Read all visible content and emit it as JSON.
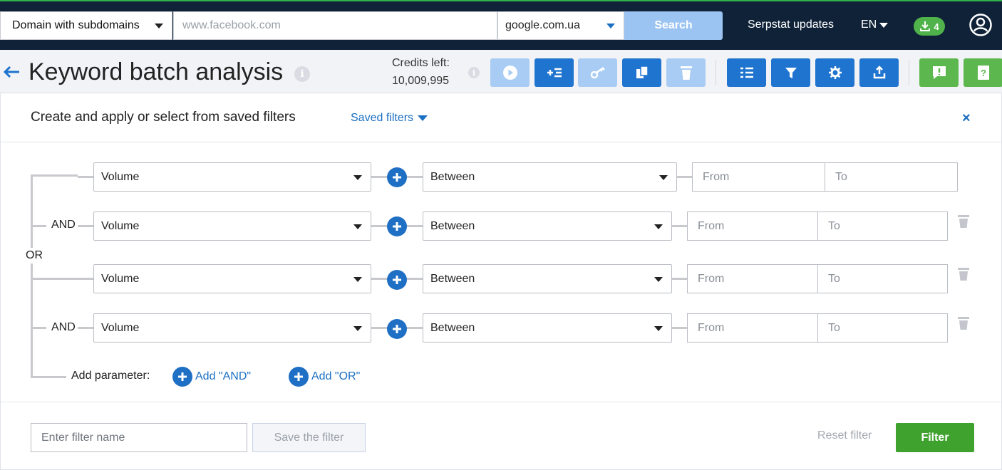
{
  "topbar": {
    "scope_selected": "Domain with subdomains",
    "domain_placeholder": "www.facebook.com",
    "database_selected": "google.com.ua",
    "search_label": "Search",
    "updates_label": "Serpstat updates",
    "language": "EN",
    "downloads_count": "4"
  },
  "header": {
    "title": "Keyword batch analysis",
    "credits_label": "Credits left:",
    "credits_value": "10,009,995",
    "toolbar_icons": [
      "play-icon",
      "add-list-icon",
      "key-icon",
      "copy-icon",
      "trash-icon",
      "list-icon",
      "filter-icon",
      "gear-icon",
      "export-icon",
      "feedback-icon",
      "help-book-icon"
    ]
  },
  "filters_panel": {
    "title": "Create and apply or select from saved filters",
    "saved_filters_label": "Saved filters",
    "close_label": "×",
    "or_label": "OR",
    "rows": [
      {
        "logic": "",
        "parameter": "Volume",
        "condition": "Between",
        "from_placeholder": "From",
        "to_placeholder": "To"
      },
      {
        "logic": "AND",
        "parameter": "Volume",
        "condition": "Between",
        "from_placeholder": "From",
        "to_placeholder": "To"
      },
      {
        "logic": "",
        "parameter": "Volume",
        "condition": "Between",
        "from_placeholder": "From",
        "to_placeholder": "To"
      },
      {
        "logic": "AND",
        "parameter": "Volume",
        "condition": "Between",
        "from_placeholder": "From",
        "to_placeholder": "To"
      }
    ],
    "add_parameter_label": "Add parameter:",
    "add_and_label": "Add \"AND\"",
    "add_or_label": "Add \"OR\""
  },
  "footer": {
    "filter_name_placeholder": "Enter filter name",
    "save_label": "Save the filter",
    "reset_label": "Reset filter",
    "filter_label": "Filter"
  },
  "colors": {
    "topbar_bg": "#0f2238",
    "accent_blue": "#1f74cf",
    "light_blue": "#a8ccf4",
    "green": "#5cb84e",
    "filter_green": "#3fa22e"
  }
}
